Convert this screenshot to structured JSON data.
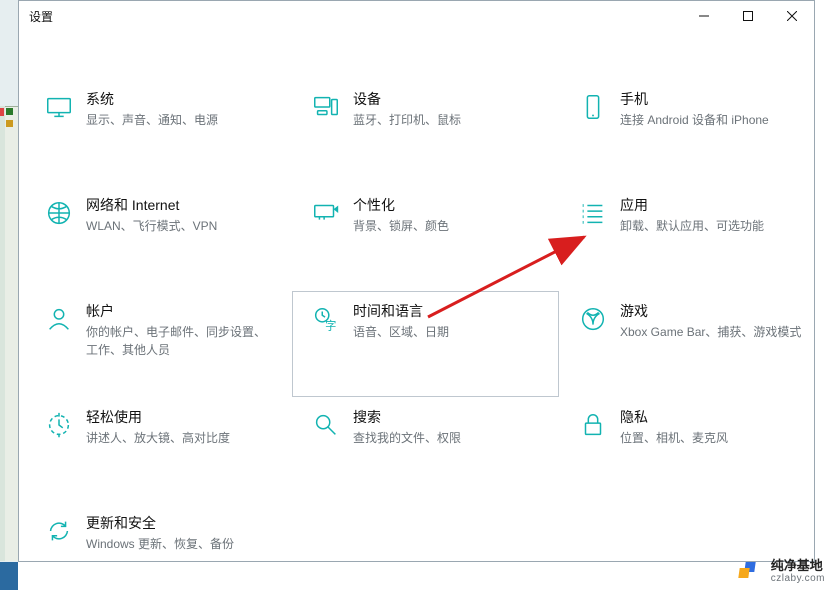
{
  "window": {
    "title": "设置"
  },
  "accent": "#12b3b1",
  "tiles": [
    {
      "id": "system",
      "icon": "monitor",
      "title": "系统",
      "sub": "显示、声音、通知、电源"
    },
    {
      "id": "devices",
      "icon": "devices",
      "title": "设备",
      "sub": "蓝牙、打印机、鼠标"
    },
    {
      "id": "phone",
      "icon": "phone",
      "title": "手机",
      "sub": "连接 Android 设备和 iPhone"
    },
    {
      "id": "network",
      "icon": "globe",
      "title": "网络和 Internet",
      "sub": "WLAN、飞行模式、VPN"
    },
    {
      "id": "personal",
      "icon": "brush",
      "title": "个性化",
      "sub": "背景、锁屏、颜色"
    },
    {
      "id": "apps",
      "icon": "list",
      "title": "应用",
      "sub": "卸载、默认应用、可选功能"
    },
    {
      "id": "accounts",
      "icon": "person",
      "title": "帐户",
      "sub": "你的帐户、电子邮件、同步设置、工作、其他人员"
    },
    {
      "id": "time",
      "icon": "time-lang",
      "title": "时间和语言",
      "sub": "语音、区域、日期"
    },
    {
      "id": "gaming",
      "icon": "xbox",
      "title": "游戏",
      "sub": "Xbox Game Bar、捕获、游戏模式"
    },
    {
      "id": "ease",
      "icon": "ease",
      "title": "轻松使用",
      "sub": "讲述人、放大镜、高对比度"
    },
    {
      "id": "search",
      "icon": "search",
      "title": "搜索",
      "sub": "查找我的文件、权限"
    },
    {
      "id": "privacy",
      "icon": "lock",
      "title": "隐私",
      "sub": "位置、相机、麦克风"
    },
    {
      "id": "update",
      "icon": "sync",
      "title": "更新和安全",
      "sub": "Windows 更新、恢复、备份"
    }
  ],
  "hovered_tile": "time",
  "watermark": {
    "line1": "纯净基地",
    "line2": "czlaby.com"
  }
}
